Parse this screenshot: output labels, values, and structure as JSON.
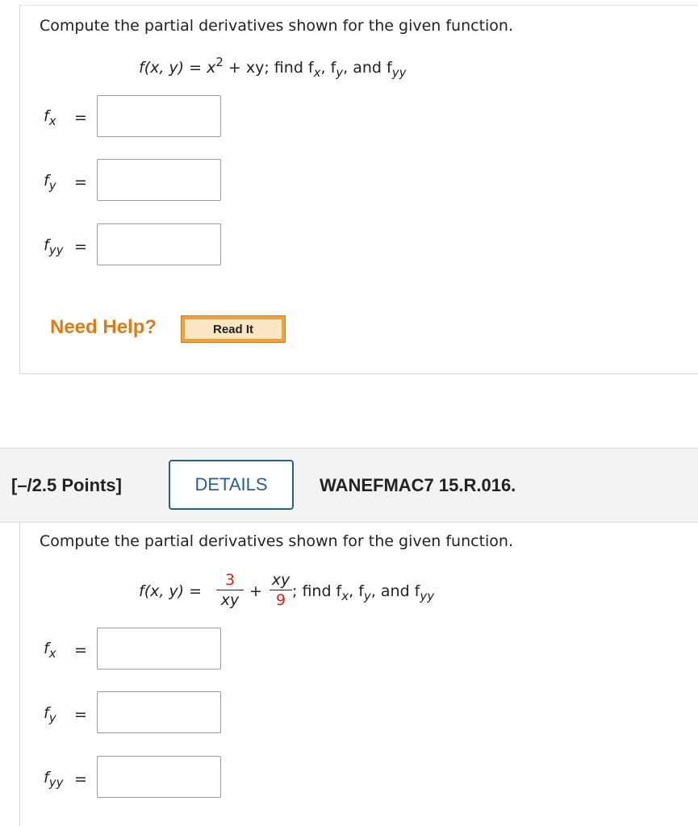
{
  "q1": {
    "prompt": "Compute the partial derivatives shown for the given function.",
    "formula": {
      "lhs": "f(x, y) = x",
      "exponent": "2",
      "rhs": " + xy; find f",
      "s1": "x",
      "c1": ", f",
      "s2": "y",
      "c2": ", and f",
      "s3": "yy"
    },
    "rows": [
      {
        "f": "f",
        "sub": "x",
        "eq": "=",
        "value": ""
      },
      {
        "f": "f",
        "sub": "y",
        "eq": "=",
        "value": ""
      },
      {
        "f": "f",
        "sub": "yy",
        "eq": "=",
        "value": ""
      }
    ],
    "need_help": "Need Help?",
    "read_it": "Read It"
  },
  "q2": {
    "points": "[–/2.5 Points]",
    "details": "DETAILS",
    "code": "WANEFMAC7 15.R.016.",
    "prompt": "Compute the partial derivatives shown for the given function.",
    "formula": {
      "lhs": "f(x, y) =",
      "frac1_num": "3",
      "frac1_den": "xy",
      "plus": "+",
      "frac2_num": "xy",
      "frac2_den": "9",
      "tail": "; find f",
      "s1": "x",
      "c1": ", f",
      "s2": "y",
      "c2": ", and f",
      "s3": "yy"
    },
    "rows": [
      {
        "f": "f",
        "sub": "x",
        "eq": "=",
        "value": ""
      },
      {
        "f": "f",
        "sub": "y",
        "eq": "=",
        "value": ""
      },
      {
        "f": "f",
        "sub": "yy",
        "eq": "=",
        "value": ""
      }
    ]
  },
  "colors": {
    "accent_orange": "#e07b14",
    "details_blue": "#2a5f86",
    "fraction_red": "#d8221d"
  }
}
